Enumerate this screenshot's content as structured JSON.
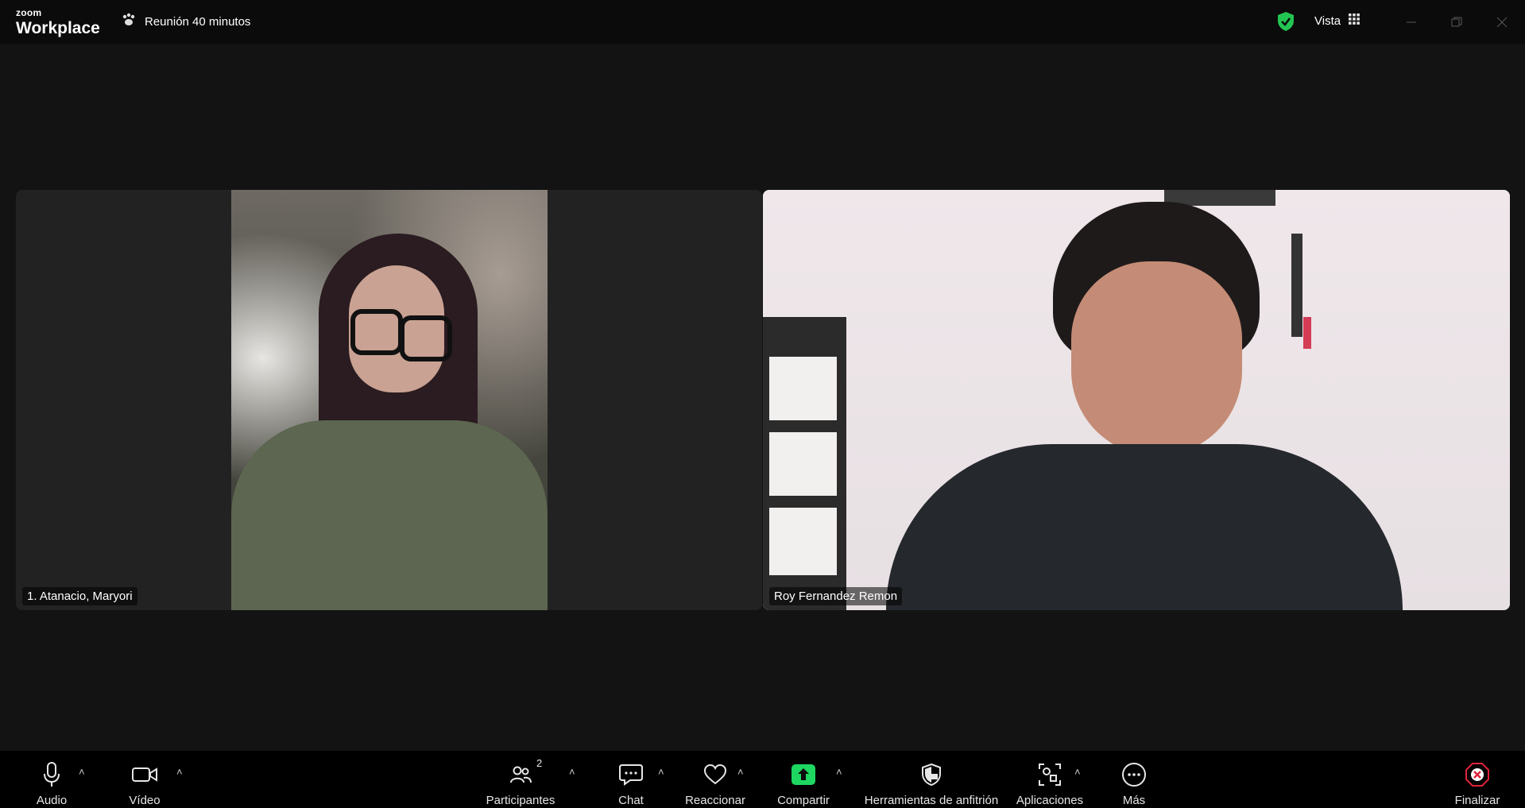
{
  "app": {
    "brand_small": "zoom",
    "brand_big": "Workplace",
    "meeting_title": "Reunión 40 minutos",
    "view_label": "Vista"
  },
  "participants": [
    {
      "name": "1. Atanacio, Maryori"
    },
    {
      "name": "Roy Fernandez Remon"
    }
  ],
  "toolbar": {
    "audio": "Audio",
    "video": "Vídeo",
    "participants": "Participantes",
    "participants_count": "2",
    "chat": "Chat",
    "react": "Reaccionar",
    "share": "Compartir",
    "host_tools": "Herramientas de anfitrión",
    "apps": "Aplicaciones",
    "more": "Más",
    "end": "Finalizar"
  },
  "colors": {
    "share_green": "#1ed760",
    "shield_green": "#23c552",
    "end_red": "#e0233a"
  },
  "icons": [
    "paw-icon",
    "shield-check-icon",
    "grid-icon",
    "minimize-icon",
    "restore-icon",
    "close-icon",
    "microphone-icon",
    "camera-icon",
    "participants-icon",
    "chat-icon",
    "heart-icon",
    "share-arrow-icon",
    "host-shield-icon",
    "apps-icon",
    "more-icon",
    "end-icon"
  ]
}
